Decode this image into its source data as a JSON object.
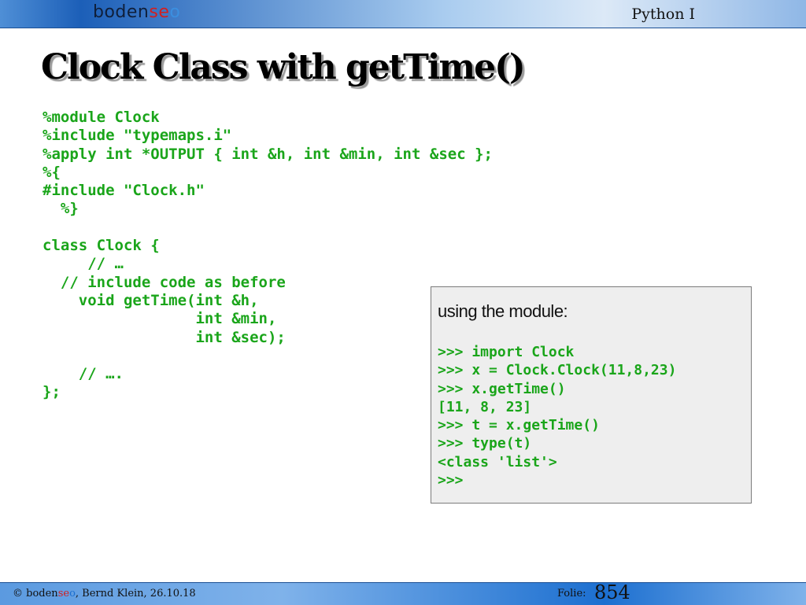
{
  "header": {
    "logo": {
      "part1": "boden",
      "part2": "se",
      "part3": "o"
    },
    "course": "Python I"
  },
  "slide": {
    "title": "Clock Class with getTime()",
    "code": "%module Clock\n%include \"typemaps.i\"\n%apply int *OUTPUT { int &h, int &min, int &sec };\n%{\n#include \"Clock.h\"\n  %}\n\nclass Clock {\n     // …\n  // include code as before\n    void getTime(int &h,\n                 int &min,\n                 int &sec);\n\n    // ….\n};"
  },
  "box": {
    "heading": "using the module:",
    "code": ">>> import Clock\n>>> x = Clock.Clock(11,8,23)\n>>> x.getTime()\n[11, 8, 23]\n>>> t = x.getTime()\n>>> type(t)\n<class 'list'>\n>>>"
  },
  "footer": {
    "copyright": "© ",
    "brand1": "boden",
    "brand2": "se",
    "brand3": "o",
    "author_date": ", Bernd Klein, 26.10.18",
    "folie_label": "Folie:",
    "page_number": "854"
  },
  "colors": {
    "code_green": "#1aa51a",
    "brand_red": "#d21f1f",
    "brand_blue": "#3b8fe0"
  }
}
